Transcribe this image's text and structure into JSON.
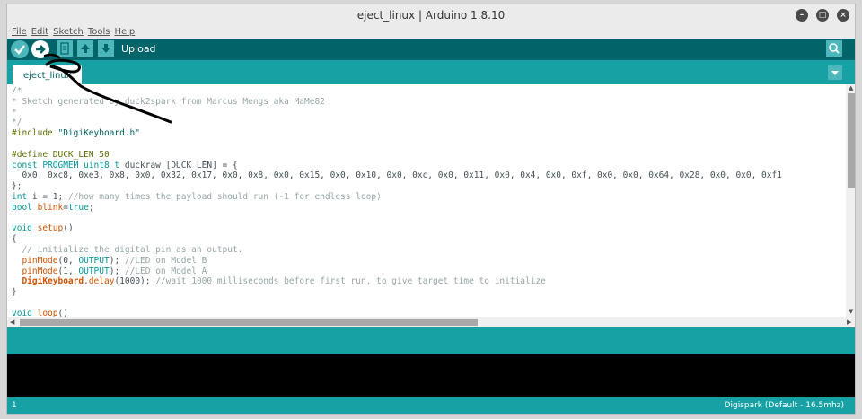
{
  "window": {
    "title": "eject_linux | Arduino 1.8.10",
    "controls": {
      "minimize": "–",
      "maximize": "□",
      "close": "×"
    }
  },
  "menu": [
    "File",
    "Edit",
    "Sketch",
    "Tools",
    "Help"
  ],
  "toolbar": {
    "buttons": [
      {
        "name": "verify",
        "icon": "check-icon"
      },
      {
        "name": "upload",
        "icon": "arrow-right-icon"
      },
      {
        "name": "new",
        "icon": "document-icon"
      },
      {
        "name": "open",
        "icon": "arrow-up-icon"
      },
      {
        "name": "save",
        "icon": "arrow-down-icon"
      }
    ],
    "hover_label": "Upload",
    "serial_monitor_icon": "magnifier-icon"
  },
  "tabs": [
    {
      "label": "eject_linux",
      "active": true
    }
  ],
  "editor": {
    "lines": [
      [
        {
          "t": "/*",
          "c": "comment"
        }
      ],
      [
        {
          "t": "* Sketch generated by duck2spark from Marcus Mengs aka MaMe82",
          "c": "comment"
        }
      ],
      [
        {
          "t": "*",
          "c": "comment"
        }
      ],
      [
        {
          "t": "*/",
          "c": "comment"
        }
      ],
      [
        {
          "t": "#include ",
          "c": "dir"
        },
        {
          "t": "\"DigiKeyboard.h\"",
          "c": "str"
        }
      ],
      [
        {
          "t": "",
          "c": ""
        }
      ],
      [
        {
          "t": "#define DUCK_LEN 50",
          "c": "dir"
        }
      ],
      [
        {
          "t": "const ",
          "c": "kw"
        },
        {
          "t": "PROGMEM ",
          "c": "kw"
        },
        {
          "t": "uint8_t ",
          "c": "kw"
        },
        {
          "t": "duckraw [DUCK_LEN] = {",
          "c": ""
        }
      ],
      [
        {
          "t": "  0x0, 0xc8, 0xe3, 0x8, 0x0, 0x32, 0x17, 0x0, 0x8, 0x0, 0x15, 0x0, 0x10, 0x0, 0xc, 0x0, 0x11, 0x0, 0x4, 0x0, 0xf, 0x0, 0x0, 0x64, 0x28, 0x0, 0x0, 0xf1",
          "c": ""
        }
      ],
      [
        {
          "t": "};",
          "c": ""
        }
      ],
      [
        {
          "t": "int ",
          "c": "kw"
        },
        {
          "t": "i = 1; ",
          "c": ""
        },
        {
          "t": "//how many times the payload should run (-1 for endless loop)",
          "c": "comment"
        }
      ],
      [
        {
          "t": "bool ",
          "c": "kw"
        },
        {
          "t": "blink",
          "c": "fn"
        },
        {
          "t": "=",
          "c": ""
        },
        {
          "t": "true",
          "c": "kw"
        },
        {
          "t": ";",
          "c": ""
        }
      ],
      [
        {
          "t": "",
          "c": ""
        }
      ],
      [
        {
          "t": "void ",
          "c": "kw"
        },
        {
          "t": "setup",
          "c": "fn"
        },
        {
          "t": "()",
          "c": ""
        }
      ],
      [
        {
          "t": "{",
          "c": ""
        }
      ],
      [
        {
          "t": "  // initialize the digital pin as an output.",
          "c": "comment"
        }
      ],
      [
        {
          "t": "  ",
          "c": ""
        },
        {
          "t": "pinMode",
          "c": "fn"
        },
        {
          "t": "(0, ",
          "c": ""
        },
        {
          "t": "OUTPUT",
          "c": "kw"
        },
        {
          "t": "); ",
          "c": ""
        },
        {
          "t": "//LED on Model B",
          "c": "comment"
        }
      ],
      [
        {
          "t": "  ",
          "c": ""
        },
        {
          "t": "pinMode",
          "c": "fn"
        },
        {
          "t": "(1, ",
          "c": ""
        },
        {
          "t": "OUTPUT",
          "c": "kw"
        },
        {
          "t": "); ",
          "c": ""
        },
        {
          "t": "//LED on Model A",
          "c": "comment"
        }
      ],
      [
        {
          "t": "  ",
          "c": ""
        },
        {
          "t": "DigiKeyboard",
          "c": "obj"
        },
        {
          "t": ".",
          "c": ""
        },
        {
          "t": "delay",
          "c": "fn"
        },
        {
          "t": "(1000); ",
          "c": ""
        },
        {
          "t": "//wait 1000 milliseconds before first run, to give target time to initialize",
          "c": "comment"
        }
      ],
      [
        {
          "t": "}",
          "c": ""
        }
      ],
      [
        {
          "t": "",
          "c": ""
        }
      ],
      [
        {
          "t": "void ",
          "c": "kw"
        },
        {
          "t": "loop",
          "c": "fn"
        },
        {
          "t": "()",
          "c": ""
        }
      ],
      [
        {
          "t": "{",
          "c": ""
        }
      ]
    ]
  },
  "status": {
    "line": "1",
    "board": "Digispark (Default - 16.5mhz)"
  },
  "colors": {
    "toolbar": "#006468",
    "accent": "#17a1a5",
    "button": "#4db7bb"
  }
}
